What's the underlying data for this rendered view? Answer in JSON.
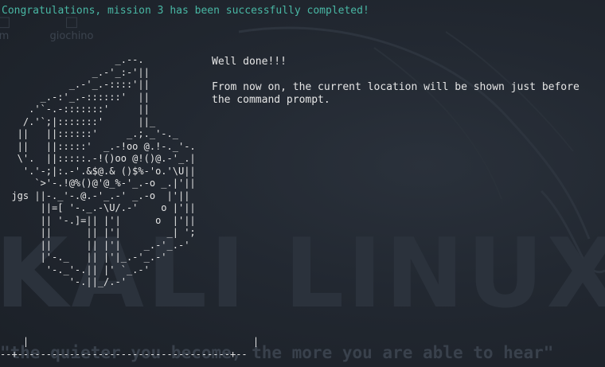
{
  "wallpaper": {
    "desktop_icons": [
      {
        "label": "m",
        "icon": "folder-icon"
      },
      {
        "label": "giochino",
        "icon": "folder-icon"
      }
    ],
    "logo_text": "KALI LINUX",
    "tagline": "\"the quieter you become, the more you are able to hear\"",
    "colors": {
      "background": "#222831",
      "watermark": "#2b323c"
    }
  },
  "terminal": {
    "mission_message": "Congratulations, mission 3 has been successfully completed!",
    "well_done": "Well done!!!",
    "location_notice_line1": "From now on, the current location will be shown just before",
    "location_notice_line2": "the command prompt.",
    "ascii_art": "                    _.--.\n                _.-'_:-'||\n            _.-'_.-::::'||\n       _.-:'_.-::::::'  ||\n     .'`-.-:::::::'     ||\n    /.'`;|:::::::'      ||_\n   ||   ||::::::'     _.;._'-._\n   ||   ||:::::'  _.-!oo @.!-._'-.\n   \\'.  ||:::::.-!()oo @!()@.-'_.|\n    '.'-;|:.-'.&$@.& ()$%-'o.'\\U||\n      `>'-.!@%()@'@_%-'_.-o _.|'||\n  jgs ||-._'-.@.-'_.-' _.-o  |'||\n       ||=[ '-._.-\\U/.-'    o |'||\n       || '-.]=|| |'|      o  |'||\n       ||      || |'|        _| ';\n       ||      || |'|    _.-'_.-'\n       |'-._   || |'|_.-'_.-'\n        '-._'-.|| |' `_.-'\n            '-.||_/.-'",
    "ground_line": "    |                                       |\n--+-------------------------------------+--",
    "colors": {
      "success": "#49b7a4",
      "text": "#e6e6e6"
    }
  }
}
